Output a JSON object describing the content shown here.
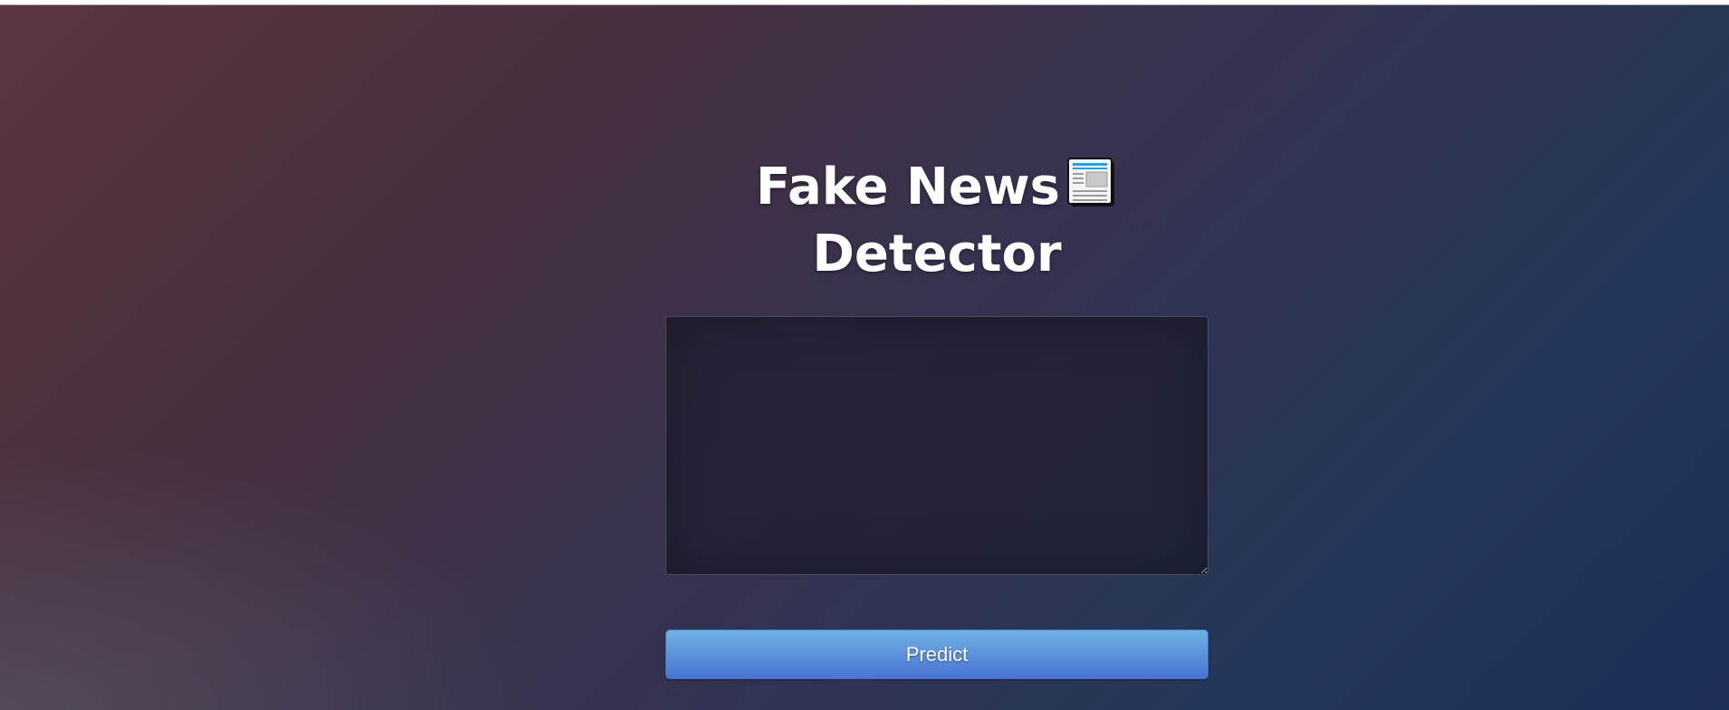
{
  "page": {
    "title_line_1": "Fake News",
    "title_line_2": "Detector",
    "title_icon": "newspaper-icon"
  },
  "form": {
    "news_text_value": "",
    "predict_label": "Predict"
  },
  "colors": {
    "background_top_left": "#5c3442",
    "background_bottom_right": "#1d2e58",
    "button_top": "#6fb2e3",
    "button_bottom": "#4a74d4",
    "icon_accent": "#1fa3e0"
  }
}
